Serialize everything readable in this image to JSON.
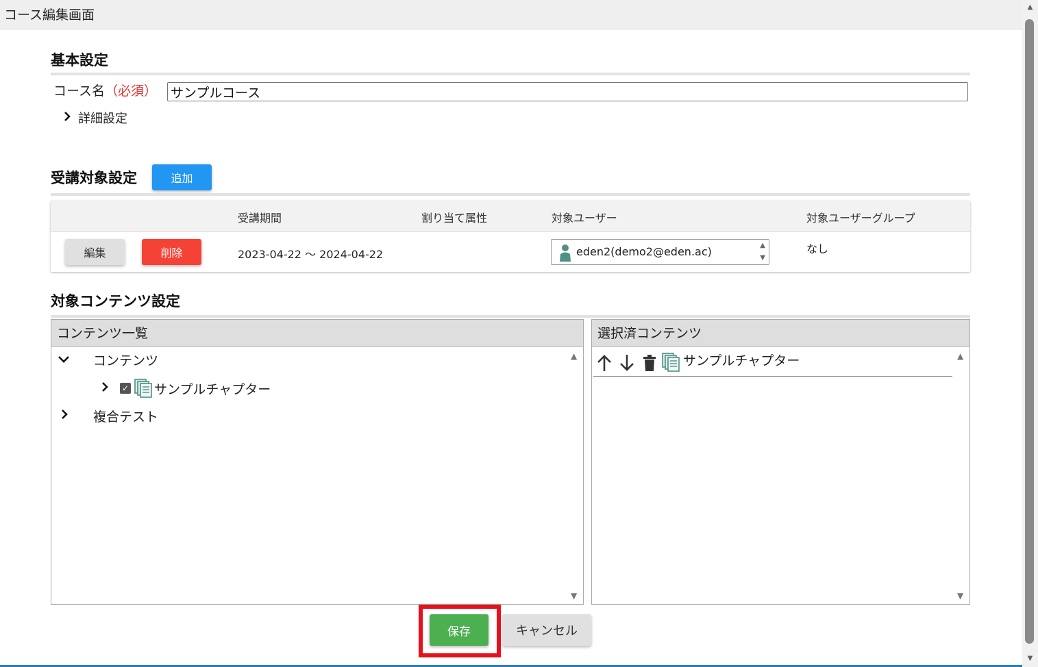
{
  "window": {
    "title": "コース編集画面"
  },
  "basic": {
    "section_title": "基本設定",
    "course_name_label": "コース名",
    "required_label": "（必須）",
    "course_name_value": "サンプルコース",
    "detail_toggle": "詳細設定"
  },
  "assign": {
    "section_title": "受講対象設定",
    "add_button": "追加",
    "columns": {
      "period": "受講期間",
      "attribute": "割り当て属性",
      "target_user": "対象ユーザー",
      "target_group": "対象ユーザーグループ"
    },
    "rows": [
      {
        "edit_button": "編集",
        "delete_button": "削除",
        "period": "2023-04-22 ～ 2024-04-22",
        "attribute": "",
        "target_user": "eden2(demo2@eden.ac)",
        "target_group": "なし"
      }
    ]
  },
  "contents": {
    "section_title": "対象コンテンツ設定",
    "list_panel": {
      "header": "コンテンツ一覧",
      "tree": [
        {
          "label": "コンテンツ",
          "expanded": true
        },
        {
          "label": "サンプルチャプター",
          "checked": true,
          "icon": "document-stack-icon"
        },
        {
          "label": "複合テスト",
          "expanded": false
        }
      ]
    },
    "selected_panel": {
      "header": "選択済コンテンツ",
      "items": [
        {
          "label": "サンプルチャプター",
          "icon": "document-stack-icon"
        }
      ]
    }
  },
  "footer": {
    "save_button": "保存",
    "cancel_button": "キャンセル"
  },
  "colors": {
    "add": "#2196f3",
    "delete": "#f44336",
    "save": "#4caf50",
    "highlight_frame": "#e8101b",
    "required": "#e53935"
  }
}
